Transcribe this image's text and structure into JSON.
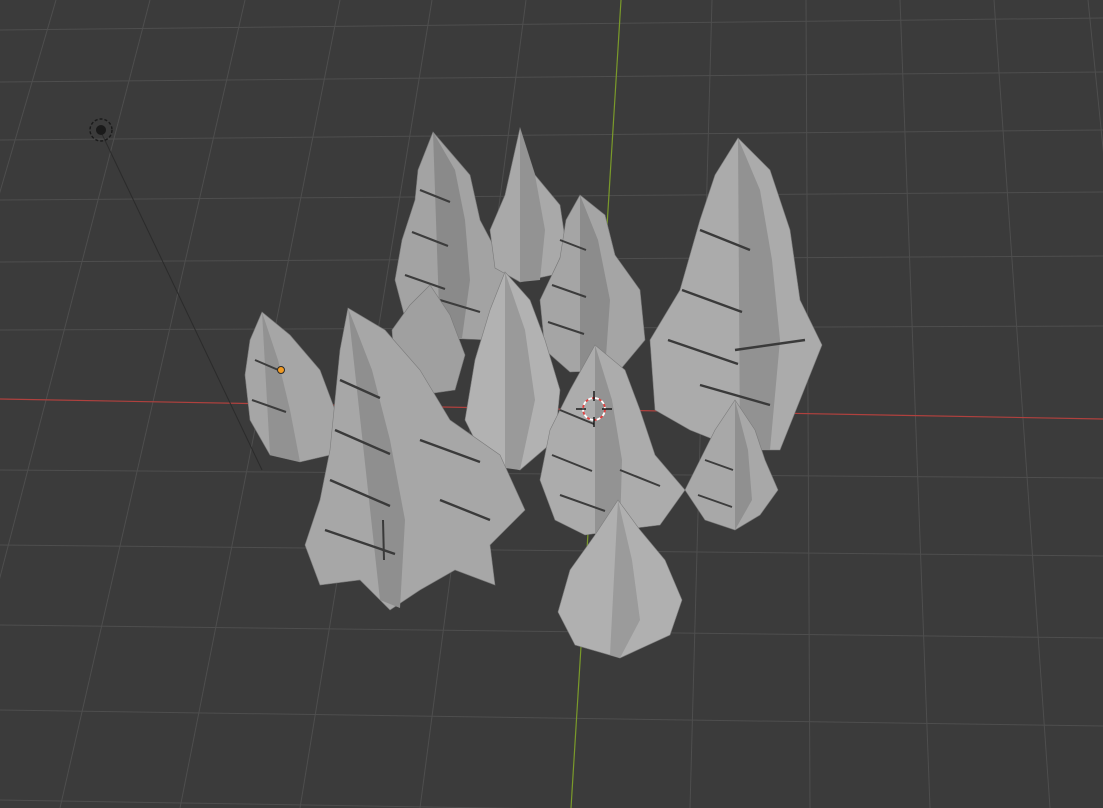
{
  "viewport": {
    "background_color": "#3a3a3a",
    "grid_color": "#505050",
    "x_axis_color": "#b0413e",
    "y_axis_color": "#7a9a2a"
  },
  "objects": {
    "light": {
      "icon": "sun-light-icon",
      "color": "#1a1a1a"
    },
    "origin_marker": {
      "icon": "origin-dot-icon",
      "color": "#f09a23"
    },
    "cursor": {
      "icon": "3d-cursor-icon",
      "color": "#e04040"
    },
    "trees": {
      "count": 11,
      "base_color": "#9c9c9c",
      "light_color": "#b8b8b8",
      "shadow_color": "#5e5e5e"
    }
  }
}
